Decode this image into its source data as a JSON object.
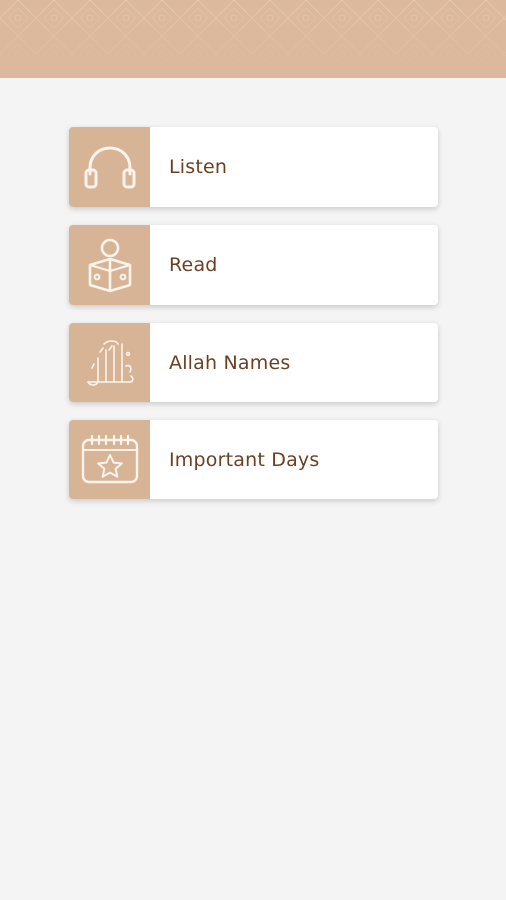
{
  "colors": {
    "header": "#dcb89c",
    "icon_tile": "#d8b496",
    "icon_stroke": "#fbf3ec",
    "label_text": "#6b3f22",
    "background": "#f4f4f4"
  },
  "menu": {
    "items": [
      {
        "label": "Listen",
        "icon": "headphones-icon"
      },
      {
        "label": "Read",
        "icon": "reading-person-icon"
      },
      {
        "label": "Allah Names",
        "icon": "allah-calligraphy-icon"
      },
      {
        "label": "Important Days",
        "icon": "calendar-star-icon"
      }
    ]
  }
}
